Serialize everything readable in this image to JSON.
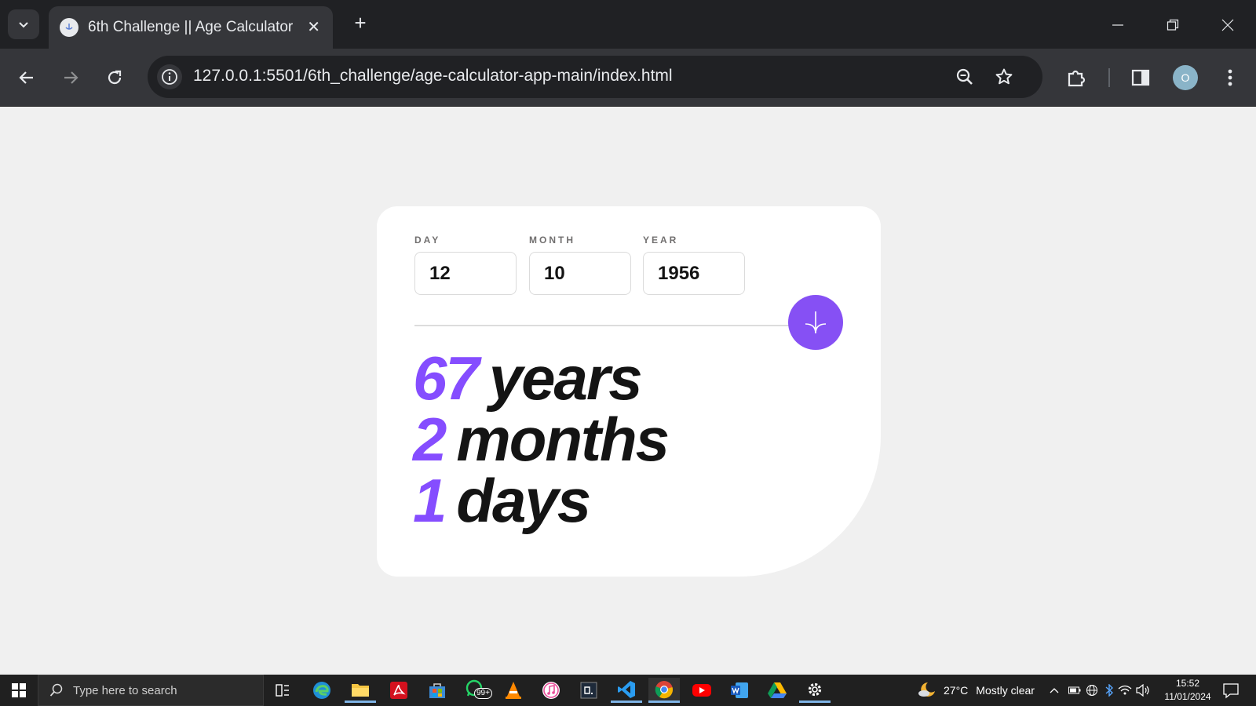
{
  "browser": {
    "tab_title": "6th Challenge || Age Calculator",
    "tab_close": "✕",
    "new_tab": "+",
    "url": "127.0.0.1:5501/6th_challenge/age-calculator-app-main/index.html",
    "profile_initial": "O"
  },
  "form": {
    "day": {
      "label": "DAY",
      "value": "12"
    },
    "month": {
      "label": "MONTH",
      "value": "10"
    },
    "year": {
      "label": "YEAR",
      "value": "1956"
    }
  },
  "results": {
    "years": {
      "value": "67",
      "unit": "years"
    },
    "months": {
      "value": "2",
      "unit": "months"
    },
    "days": {
      "value": "1",
      "unit": "days"
    }
  },
  "colors": {
    "accent": "#854dff",
    "card": "#ffffff",
    "page": "#f0f0f0",
    "ink": "#141414"
  },
  "taskbar": {
    "search_placeholder": "Type here to search",
    "whatsapp_badge": "99+",
    "weather": {
      "temp": "27°C",
      "condition": "Mostly clear"
    },
    "clock": {
      "time": "15:52",
      "date": "11/01/2024"
    },
    "apps": [
      "task-view-icon",
      "edge-icon",
      "file-explorer-icon",
      "acrobat-icon",
      "store-icon",
      "whatsapp-icon",
      "vlc-icon",
      "itunes-icon",
      "terminal-icon",
      "vscode-icon",
      "chrome-icon",
      "youtube-icon",
      "word-icon",
      "drive-icon",
      "settings-icon"
    ]
  }
}
